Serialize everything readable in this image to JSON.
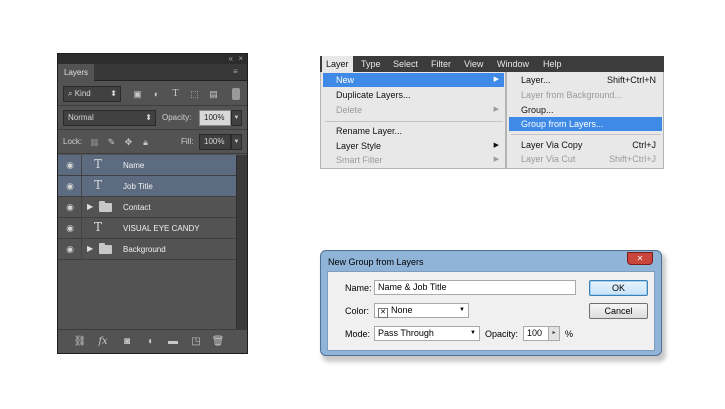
{
  "layers_panel": {
    "tab": "Layers",
    "top_controls": {
      "collapse": "«",
      "close": "×"
    },
    "menu_icon": "≡",
    "filter": {
      "icon": "search-icon",
      "value": "Kind",
      "arrows": "⬍"
    },
    "blend_mode": "Normal",
    "opacity_label": "Opacity:",
    "opacity_value": "100%",
    "lock_label": "Lock:",
    "fill_label": "Fill:",
    "fill_value": "100%",
    "layers": [
      {
        "name": "Name",
        "kind": "text",
        "selected": true
      },
      {
        "name": "Job Title",
        "kind": "text",
        "selected": true
      },
      {
        "name": "Contact",
        "kind": "group",
        "selected": false
      },
      {
        "name": "VISUAL EYE CANDY",
        "kind": "text",
        "selected": false
      },
      {
        "name": "Background",
        "kind": "group",
        "selected": false
      }
    ],
    "glyphs": {
      "text_layer": "T",
      "eye": "◉",
      "expand": "▶"
    }
  },
  "menubar": {
    "items": [
      "Layer",
      "Type",
      "Select",
      "Filter",
      "View",
      "Window",
      "Help"
    ],
    "active": "Layer"
  },
  "layer_menu": {
    "items": [
      {
        "label": "New",
        "highlight": true,
        "submenu": true
      },
      {
        "label": "Duplicate Layers...",
        "disabled": false
      },
      {
        "label": "Delete",
        "disabled": true,
        "submenu": true
      },
      {
        "label": "Rename Layer...",
        "disabled": false
      },
      {
        "label": "Layer Style",
        "disabled": false,
        "submenu": true
      },
      {
        "label": "Smart Filter",
        "disabled": true,
        "submenu": true
      }
    ],
    "submenu_arrow": "▶"
  },
  "new_submenu": {
    "items": [
      {
        "label": "Layer...",
        "shortcut": "Shift+Ctrl+N",
        "disabled": false
      },
      {
        "label": "Layer from Background...",
        "shortcut": "",
        "disabled": true
      },
      {
        "label": "Group...",
        "shortcut": "",
        "disabled": false
      },
      {
        "label": "Group from Layers...",
        "shortcut": "",
        "highlight": true
      },
      {
        "label": "Layer Via Copy",
        "shortcut": "Ctrl+J",
        "disabled": false
      },
      {
        "label": "Layer Via Cut",
        "shortcut": "Shift+Ctrl+J",
        "disabled": true
      }
    ]
  },
  "dialog": {
    "title": "New Group from Layers",
    "close_glyph": "✕",
    "name_label": "Name:",
    "name_value": "Name & Job Title",
    "color_label": "Color:",
    "color_value": "None",
    "color_swatch": "✕",
    "mode_label": "Mode:",
    "mode_value": "Pass Through",
    "opacity_label": "Opacity:",
    "opacity_value": "100",
    "opacity_unit": "%",
    "spin_glyph": "▸",
    "dropdown_glyph": "▼",
    "ok_label": "OK",
    "cancel_label": "Cancel"
  }
}
